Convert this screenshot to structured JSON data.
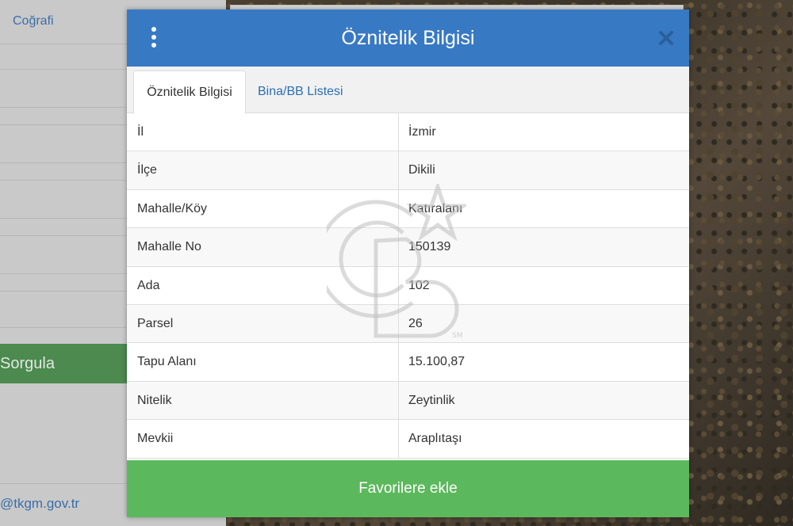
{
  "sidebar": {
    "top_link": "Coğrafi",
    "query_button": "Sorgula",
    "email_fragment": "@tkgm.gov.tr"
  },
  "modal": {
    "title": "Öznitelik Bilgisi",
    "tabs": [
      {
        "label": "Öznitelik Bilgisi",
        "active": true
      },
      {
        "label": "Bina/BB Listesi",
        "active": false
      }
    ],
    "rows": [
      {
        "key": "İl",
        "value": "İzmir"
      },
      {
        "key": "İlçe",
        "value": "Dikili"
      },
      {
        "key": "Mahalle/Köy",
        "value": "Katıralanı"
      },
      {
        "key": "Mahalle No",
        "value": "150139"
      },
      {
        "key": "Ada",
        "value": "102"
      },
      {
        "key": "Parsel",
        "value": "26"
      },
      {
        "key": "Tapu Alanı",
        "value": "15.100,87"
      },
      {
        "key": "Nitelik",
        "value": "Zeytinlik"
      },
      {
        "key": "Mevkii",
        "value": "Araplıtaşı"
      }
    ],
    "add_favorites": "Favorilere ekle"
  },
  "watermark": {
    "mark": "SM"
  },
  "colors": {
    "header": "#3879c4",
    "add_button": "#5cb85c",
    "query_button": "#4c8a4f",
    "link": "#2a6fb0"
  },
  "icons": {
    "menu": "vertical-dots-icon",
    "close": "close-x-icon"
  }
}
